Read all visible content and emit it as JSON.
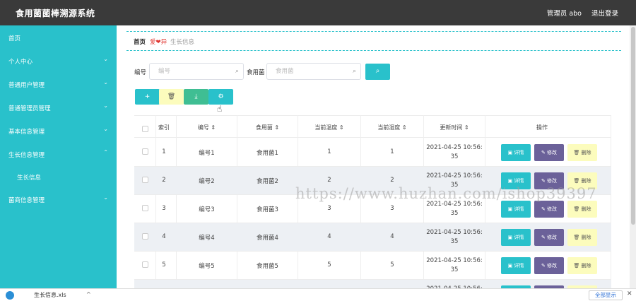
{
  "app": {
    "title": "食用菌菌棒溯源系统",
    "user": "管理员 abo",
    "logout": "退出登录"
  },
  "sidebar": {
    "items": [
      {
        "label": "首页",
        "chevron": ""
      },
      {
        "label": "个人中心",
        "chevron": "⌄"
      },
      {
        "label": "普通用户管理",
        "chevron": "⌄"
      },
      {
        "label": "普通管理员管理",
        "chevron": "⌄"
      },
      {
        "label": "基本信息管理",
        "chevron": "⌄"
      },
      {
        "label": "生长信息管理",
        "chevron": "⌃"
      },
      {
        "label": "生长信息",
        "chevron": ""
      },
      {
        "label": "菌商信息管理",
        "chevron": "⌄"
      }
    ]
  },
  "breadcrumb": {
    "home": "首页",
    "heart": "爱❤异",
    "current": "生长信息"
  },
  "filters": {
    "bianhao_label": "编号",
    "bianhao_placeholder": "编号",
    "shiyongjun_label": "食用菌",
    "shiyongjun_placeholder": "食用菌",
    "search_icon": "⌕"
  },
  "toolbar": {
    "add": "+",
    "delete": "🗑",
    "export": "⤓",
    "settings": "⚙"
  },
  "table": {
    "headers": [
      "索引",
      "编号 ⇕",
      "食用菌 ⇕",
      "当前温度 ⇕",
      "当前湿度 ⇕",
      "更新时间 ⇕",
      "操作"
    ],
    "rows": [
      {
        "index": "1",
        "code": "编号1",
        "fungus": "食用菌1",
        "temp": "1",
        "humidity": "1",
        "time1": "2021-04-25 10:56:",
        "time2": "35"
      },
      {
        "index": "2",
        "code": "编号2",
        "fungus": "食用菌2",
        "temp": "2",
        "humidity": "2",
        "time1": "2021-04-25 10:56:",
        "time2": "35"
      },
      {
        "index": "3",
        "code": "编号3",
        "fungus": "食用菌3",
        "temp": "3",
        "humidity": "3",
        "time1": "2021-04-25 10:56:",
        "time2": "35"
      },
      {
        "index": "4",
        "code": "编号4",
        "fungus": "食用菌4",
        "temp": "4",
        "humidity": "4",
        "time1": "2021-04-25 10:56:",
        "time2": "35"
      },
      {
        "index": "5",
        "code": "编号5",
        "fungus": "食用菌5",
        "temp": "5",
        "humidity": "5",
        "time1": "2021-04-25 10:56:",
        "time2": "35"
      },
      {
        "index": "",
        "code": "",
        "fungus": "",
        "temp": "",
        "humidity": "",
        "time1": "2021-04-25 10:56:",
        "time2": ""
      }
    ],
    "actions": {
      "detail": "▣ 详情",
      "edit": "✎ 修改",
      "delete": "🗑 删除"
    }
  },
  "watermark": "https://www.huzhan.com/ishop39397",
  "download_bar": {
    "filename": "生长信息.xls",
    "caret": "^",
    "show_all": "全部显示",
    "close": "✕"
  }
}
